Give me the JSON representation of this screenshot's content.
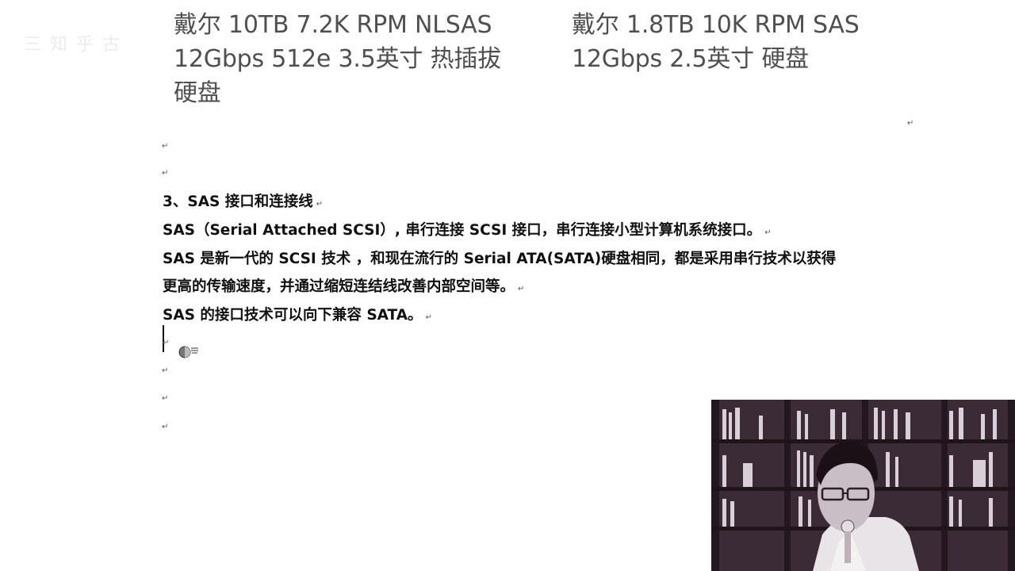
{
  "watermark": "三 知 乎 古",
  "products": {
    "left": {
      "lines": [
        "戴尔 10TB 7.2K RPM NLSAS",
        "12Gbps 512e 3.5英寸 热插拔",
        "硬盘"
      ]
    },
    "right": {
      "lines": [
        "戴尔 1.8TB 10K RPM SAS",
        "12Gbps 2.5英寸 硬盘"
      ]
    }
  },
  "paragraph_mark": "↵",
  "document": {
    "heading": "3、SAS 接口和连接线",
    "lines": [
      "SAS（Serial  Attached SCSI）, 串行连接 SCSI 接口，串行连接小型计算机系统接口。",
      "SAS 是新一代的 SCSI 技术 ，和现在流行的 Serial  ATA(SATA)硬盘相同，都是采用串行技术以获得",
      "更高的传输速度，并通过缩短连结线改善内部空间等。",
      "SAS 的接口技术可以向下兼容 SATA。"
    ]
  },
  "colors": {
    "product_text": "#4f4f4f",
    "body_text": "#111111",
    "webcam_bg": "#3a2a36"
  },
  "icons": {
    "cursor": "busy-pointer-icon",
    "webcam": "webcam-presenter-overlay"
  }
}
